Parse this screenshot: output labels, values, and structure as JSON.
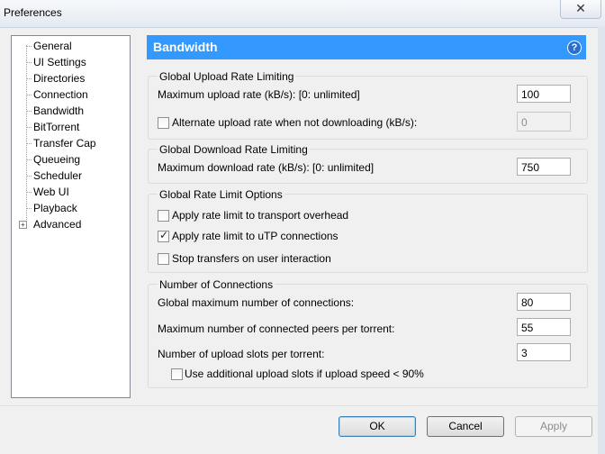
{
  "window": {
    "title": "Preferences",
    "close_glyph": "✕"
  },
  "nav": {
    "items": [
      {
        "label": "General"
      },
      {
        "label": "UI Settings"
      },
      {
        "label": "Directories"
      },
      {
        "label": "Connection"
      },
      {
        "label": "Bandwidth"
      },
      {
        "label": "BitTorrent"
      },
      {
        "label": "Transfer Cap"
      },
      {
        "label": "Queueing"
      },
      {
        "label": "Scheduler"
      },
      {
        "label": "Web UI"
      },
      {
        "label": "Playback"
      },
      {
        "label": "Advanced"
      }
    ],
    "expander_glyph": "+"
  },
  "header": {
    "title": "Bandwidth",
    "help_glyph": "?"
  },
  "upload": {
    "group_title": "Global Upload Rate Limiting",
    "max_rate_label": "Maximum upload rate (kB/s): [0: unlimited]",
    "max_rate_value": "100",
    "alt_rate_label": "Alternate upload rate when not downloading (kB/s):",
    "alt_rate_checked": false,
    "alt_rate_value": "0"
  },
  "download": {
    "group_title": "Global Download Rate Limiting",
    "max_rate_label": "Maximum download rate (kB/s): [0: unlimited]",
    "max_rate_value": "750"
  },
  "options": {
    "group_title": "Global Rate Limit Options",
    "transport_label": "Apply rate limit to transport overhead",
    "transport_checked": false,
    "utp_label": "Apply rate limit to uTP connections",
    "utp_checked": true,
    "stop_label": "Stop transfers on user interaction",
    "stop_checked": false,
    "check_glyph": "✓"
  },
  "connections": {
    "group_title": "Number of Connections",
    "global_max_label": "Global maximum number of connections:",
    "global_max_value": "80",
    "peers_label": "Maximum number of connected peers per torrent:",
    "peers_value": "55",
    "slots_label": "Number of upload slots per torrent:",
    "slots_value": "3",
    "extra_slots_label": "Use additional upload slots if upload speed < 90%",
    "extra_slots_checked": false
  },
  "buttons": {
    "ok": "OK",
    "cancel": "Cancel",
    "apply": "Apply"
  }
}
